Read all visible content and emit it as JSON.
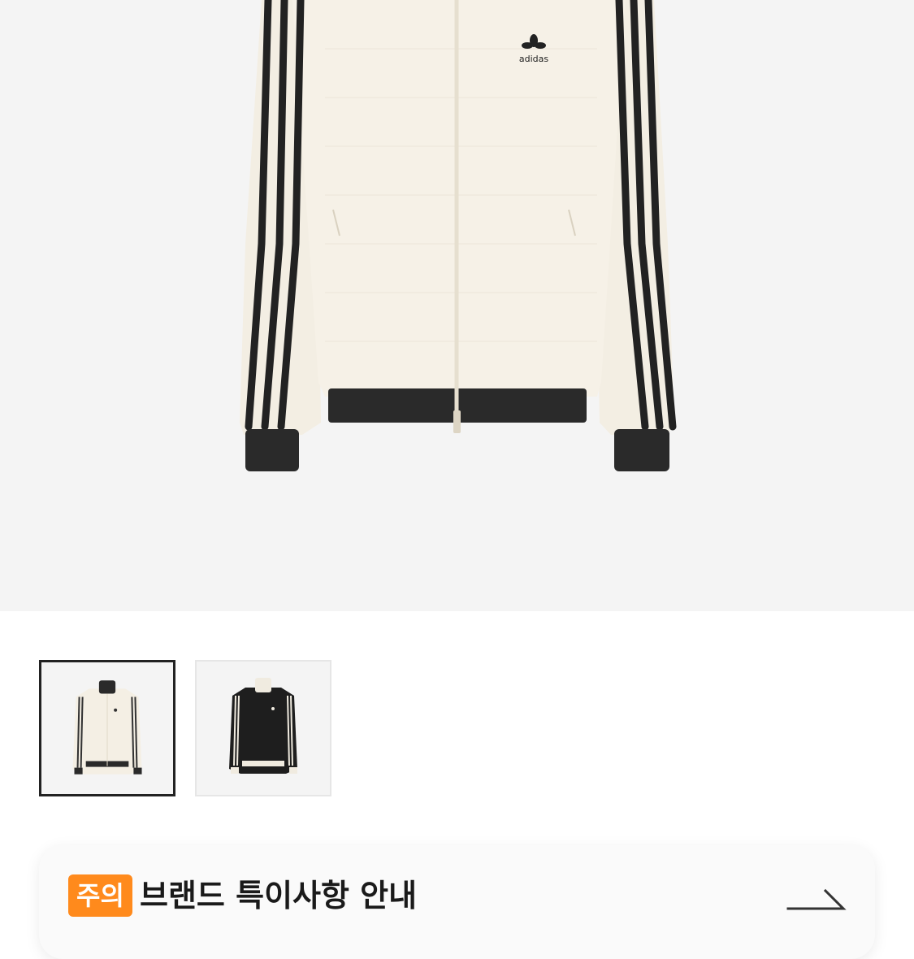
{
  "product": {
    "brand_logo_text": "adidas",
    "image_alt": "adidas cream waffle track jacket"
  },
  "thumbnails": [
    {
      "name": "cream jacket",
      "selected": true
    },
    {
      "name": "black jacket",
      "selected": false
    }
  ],
  "notice": {
    "badge": "주의",
    "title": "브랜드 특이사항 안내"
  },
  "colors": {
    "accent": "#ff8a1c",
    "hero_bg": "#f4f4f4",
    "jacket": "#f3eee3",
    "stripe": "#222222"
  }
}
